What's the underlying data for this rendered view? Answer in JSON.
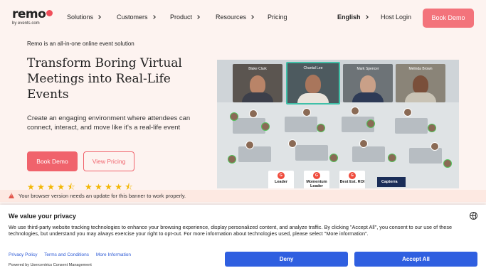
{
  "logo": {
    "word": "remo",
    "sub": "by events.com"
  },
  "nav": {
    "items": [
      {
        "label": "Solutions"
      },
      {
        "label": "Customers"
      },
      {
        "label": "Product"
      },
      {
        "label": "Resources"
      },
      {
        "label": "Pricing"
      }
    ],
    "language": "English",
    "host_login": "Host Login",
    "book_demo": "Book Demo"
  },
  "hero": {
    "eyebrow": "Remo is an all-in-one online event solution",
    "headline": "Transform Boring Virtual Meetings into Real-Life Events",
    "subhead": "Create an engaging environment where attendees can connect, interact, and move like it's a real-life event",
    "book_demo": "Book Demo",
    "view_pricing": "View Pricing",
    "ratings": [
      4.5,
      4.5
    ],
    "star_color": "#f2b705"
  },
  "hero_image": {
    "participants": [
      "Blake Clark",
      "Chantal Lee",
      "Mark Spencer",
      "Melinda Brown"
    ],
    "badges": [
      "Leader",
      "Momentum Leader",
      "Best Est. ROI"
    ],
    "capterra": "Capterra"
  },
  "warning": {
    "text": "Your browser version needs an update for this banner to work properly."
  },
  "consent": {
    "title": "We value your privacy",
    "body": "We use third-party website tracking technologies to enhance your browsing experience, display personalized content, and analyze traffic. By clicking \"Accept All\", you consent to our use of these technologies, but understand you may always exercise your right to opt-out. For more information about technologies used, please select \"More information\".",
    "links": [
      "Privacy Policy",
      "Terms and Conditions",
      "More Information"
    ],
    "powered_by": "Powered by Usercentrics Consent Management",
    "deny": "Deny",
    "accept_all": "Accept All"
  },
  "colors": {
    "brand": "#f0636c",
    "consent_button": "#2f5fe0",
    "background": "#fdf3f0"
  }
}
